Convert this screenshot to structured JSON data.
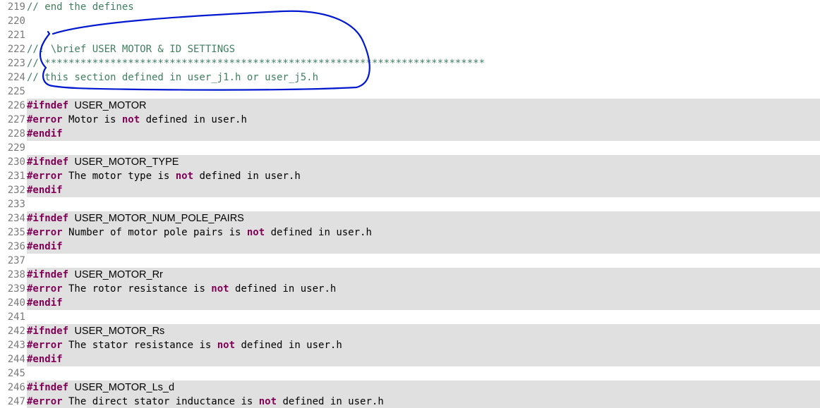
{
  "editor": {
    "colors": {
      "comment": "#3f7f5f",
      "directive": "#7f0055",
      "line_number": "#7a7a7a",
      "inactive_background": "#e0e0e0",
      "annotation": "#0018d0"
    },
    "lines": [
      {
        "number": "219",
        "inactive": false,
        "tokens": [
          {
            "type": "comment",
            "text": "// end the defines"
          }
        ]
      },
      {
        "number": "220",
        "inactive": false,
        "tokens": []
      },
      {
        "number": "221",
        "inactive": false,
        "tokens": []
      },
      {
        "number": "222",
        "inactive": false,
        "tokens": [
          {
            "type": "comment",
            "text": "//! \\brief USER MOTOR & ID SETTINGS"
          }
        ]
      },
      {
        "number": "223",
        "inactive": false,
        "tokens": [
          {
            "type": "comment",
            "text": "// **************************************************************************"
          }
        ]
      },
      {
        "number": "224",
        "inactive": false,
        "tokens": [
          {
            "type": "comment",
            "text": "// this section defined in user_j1.h or user_j5.h"
          }
        ]
      },
      {
        "number": "225",
        "inactive": false,
        "tokens": []
      },
      {
        "number": "226",
        "inactive": true,
        "tokens": [
          {
            "type": "directive",
            "text": "#ifndef"
          },
          {
            "type": "plain",
            "text": " "
          },
          {
            "type": "macro",
            "text": "USER_MOTOR"
          }
        ]
      },
      {
        "number": "227",
        "inactive": true,
        "tokens": [
          {
            "type": "directive",
            "text": "#error"
          },
          {
            "type": "plain",
            "text": " Motor is "
          },
          {
            "type": "keyword",
            "text": "not"
          },
          {
            "type": "plain",
            "text": " defined in user.h"
          }
        ]
      },
      {
        "number": "228",
        "inactive": true,
        "tokens": [
          {
            "type": "directive",
            "text": "#endif"
          }
        ]
      },
      {
        "number": "229",
        "inactive": false,
        "tokens": []
      },
      {
        "number": "230",
        "inactive": true,
        "tokens": [
          {
            "type": "directive",
            "text": "#ifndef"
          },
          {
            "type": "plain",
            "text": " "
          },
          {
            "type": "macro",
            "text": "USER_MOTOR_TYPE"
          }
        ]
      },
      {
        "number": "231",
        "inactive": true,
        "tokens": [
          {
            "type": "directive",
            "text": "#error"
          },
          {
            "type": "plain",
            "text": " The motor type is "
          },
          {
            "type": "keyword",
            "text": "not"
          },
          {
            "type": "plain",
            "text": " defined in user.h"
          }
        ]
      },
      {
        "number": "232",
        "inactive": true,
        "tokens": [
          {
            "type": "directive",
            "text": "#endif"
          }
        ]
      },
      {
        "number": "233",
        "inactive": false,
        "tokens": []
      },
      {
        "number": "234",
        "inactive": true,
        "tokens": [
          {
            "type": "directive",
            "text": "#ifndef"
          },
          {
            "type": "plain",
            "text": " "
          },
          {
            "type": "macro",
            "text": "USER_MOTOR_NUM_POLE_PAIRS"
          }
        ]
      },
      {
        "number": "235",
        "inactive": true,
        "tokens": [
          {
            "type": "directive",
            "text": "#error"
          },
          {
            "type": "plain",
            "text": " Number of motor pole pairs is "
          },
          {
            "type": "keyword",
            "text": "not"
          },
          {
            "type": "plain",
            "text": " defined in user.h"
          }
        ]
      },
      {
        "number": "236",
        "inactive": true,
        "tokens": [
          {
            "type": "directive",
            "text": "#endif"
          }
        ]
      },
      {
        "number": "237",
        "inactive": false,
        "tokens": []
      },
      {
        "number": "238",
        "inactive": true,
        "tokens": [
          {
            "type": "directive",
            "text": "#ifndef"
          },
          {
            "type": "plain",
            "text": " "
          },
          {
            "type": "macro",
            "text": "USER_MOTOR_Rr"
          }
        ]
      },
      {
        "number": "239",
        "inactive": true,
        "tokens": [
          {
            "type": "directive",
            "text": "#error"
          },
          {
            "type": "plain",
            "text": " The rotor resistance is "
          },
          {
            "type": "keyword",
            "text": "not"
          },
          {
            "type": "plain",
            "text": " defined in user.h"
          }
        ]
      },
      {
        "number": "240",
        "inactive": true,
        "tokens": [
          {
            "type": "directive",
            "text": "#endif"
          }
        ]
      },
      {
        "number": "241",
        "inactive": false,
        "tokens": []
      },
      {
        "number": "242",
        "inactive": true,
        "tokens": [
          {
            "type": "directive",
            "text": "#ifndef"
          },
          {
            "type": "plain",
            "text": " "
          },
          {
            "type": "macro",
            "text": "USER_MOTOR_Rs"
          }
        ]
      },
      {
        "number": "243",
        "inactive": true,
        "tokens": [
          {
            "type": "directive",
            "text": "#error"
          },
          {
            "type": "plain",
            "text": " The stator resistance is "
          },
          {
            "type": "keyword",
            "text": "not"
          },
          {
            "type": "plain",
            "text": " defined in user.h"
          }
        ]
      },
      {
        "number": "244",
        "inactive": true,
        "tokens": [
          {
            "type": "directive",
            "text": "#endif"
          }
        ]
      },
      {
        "number": "245",
        "inactive": false,
        "tokens": []
      },
      {
        "number": "246",
        "inactive": true,
        "tokens": [
          {
            "type": "directive",
            "text": "#ifndef"
          },
          {
            "type": "plain",
            "text": " "
          },
          {
            "type": "macro",
            "text": "USER_MOTOR_Ls_d"
          }
        ]
      },
      {
        "number": "247",
        "inactive": true,
        "tokens": [
          {
            "type": "directive",
            "text": "#error"
          },
          {
            "type": "plain",
            "text": " The direct stator inductance is "
          },
          {
            "type": "keyword",
            "text": "not"
          },
          {
            "type": "plain",
            "text": " defined in user.h"
          }
        ]
      }
    ]
  }
}
